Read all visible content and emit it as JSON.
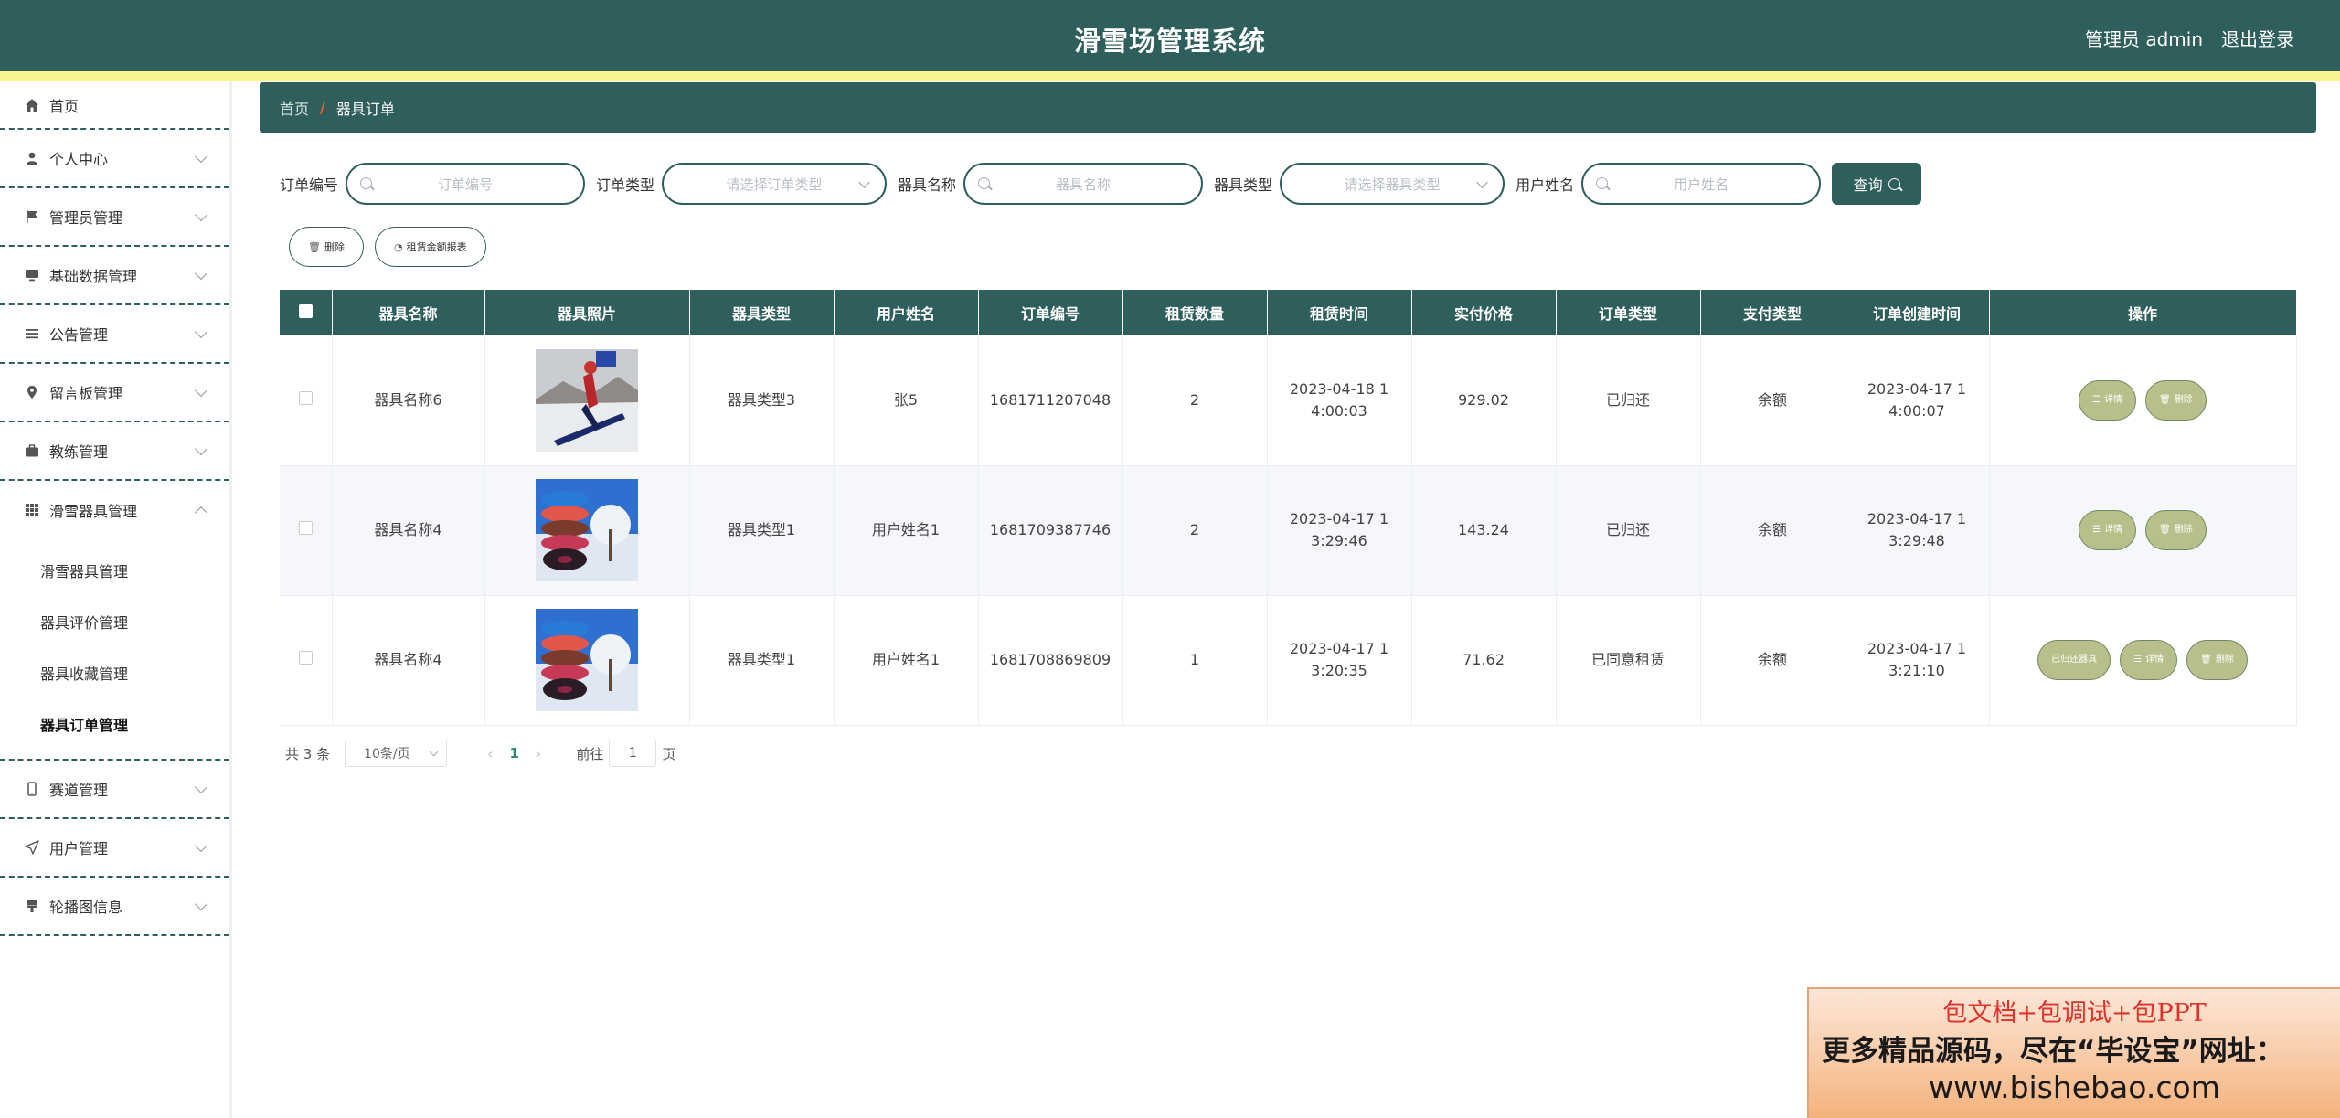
{
  "header": {
    "title": "滑雪场管理系统",
    "admin_label": "管理员 admin",
    "logout_label": "退出登录"
  },
  "sidebar": {
    "items": [
      {
        "label": "首页",
        "icon": "home-icon"
      },
      {
        "label": "个人中心",
        "icon": "user-icon"
      },
      {
        "label": "管理员管理",
        "icon": "flag-icon"
      },
      {
        "label": "基础数据管理",
        "icon": "monitor-icon"
      },
      {
        "label": "公告管理",
        "icon": "list-icon"
      },
      {
        "label": "留言板管理",
        "icon": "location-icon"
      },
      {
        "label": "教练管理",
        "icon": "briefcase-icon"
      },
      {
        "label": "滑雪器具管理",
        "icon": "grid-icon"
      },
      {
        "label": "赛道管理",
        "icon": "phone-icon"
      },
      {
        "label": "用户管理",
        "icon": "send-icon"
      },
      {
        "label": "轮播图信息",
        "icon": "brush-icon"
      }
    ],
    "submenu": [
      "滑雪器具管理",
      "器具评价管理",
      "器具收藏管理",
      "器具订单管理"
    ]
  },
  "breadcrumb": {
    "home": "首页",
    "separator": "/",
    "current": "器具订单"
  },
  "search": {
    "order_no_label": "订单编号",
    "order_no_placeholder": "订单编号",
    "order_type_label": "订单类型",
    "order_type_placeholder": "请选择订单类型",
    "equip_name_label": "器具名称",
    "equip_name_placeholder": "器具名称",
    "equip_type_label": "器具类型",
    "equip_type_placeholder": "请选择器具类型",
    "user_name_label": "用户姓名",
    "user_name_placeholder": "用户姓名",
    "query_label": "查询"
  },
  "actions": {
    "delete_label": "删除",
    "report_label": "租赁金额报表"
  },
  "table": {
    "columns": [
      "器具名称",
      "器具照片",
      "器具类型",
      "用户姓名",
      "订单编号",
      "租赁数量",
      "租赁时间",
      "实付价格",
      "订单类型",
      "支付类型",
      "订单创建时间",
      "操作"
    ],
    "rows": [
      {
        "name": "器具名称6",
        "type": "器具类型3",
        "user": "张5",
        "order_no": "1681711207048",
        "qty": "2",
        "rent_time": "2023-04-18 14:00:03",
        "price": "929.02",
        "order_type": "已归还",
        "pay_type": "余额",
        "created": "2023-04-17 14:00:07",
        "photo": "skier"
      },
      {
        "name": "器具名称4",
        "type": "器具类型1",
        "user": "用户姓名1",
        "order_no": "1681709387746",
        "qty": "2",
        "rent_time": "2023-04-17 13:29:46",
        "price": "143.24",
        "order_type": "已归还",
        "pay_type": "余额",
        "created": "2023-04-17 13:29:48",
        "photo": "tubes"
      },
      {
        "name": "器具名称4",
        "type": "器具类型1",
        "user": "用户姓名1",
        "order_no": "1681708869809",
        "qty": "1",
        "rent_time": "2023-04-17 13:20:35",
        "price": "71.62",
        "order_type": "已同意租赁",
        "pay_type": "余额",
        "created": "2023-04-17 13:21:10",
        "photo": "tubes"
      }
    ],
    "op_detail": "详情",
    "op_delete": "删除",
    "op_return": "已归还器具"
  },
  "pagination": {
    "total": "共 3 条",
    "page_size": "10条/页",
    "current_page": "1",
    "goto_label": "前往",
    "goto_value": "1",
    "page_suffix": "页"
  },
  "ad": {
    "line1": "包文档+包调试+包PPT",
    "line2": "更多精品源码，尽在“毕设宝”网址：",
    "line3": "www.bishebao.com"
  },
  "colors": {
    "primary": "#2e5f5c",
    "accent_yellow": "#f8f58f",
    "op_button": "#b9bf8a"
  }
}
